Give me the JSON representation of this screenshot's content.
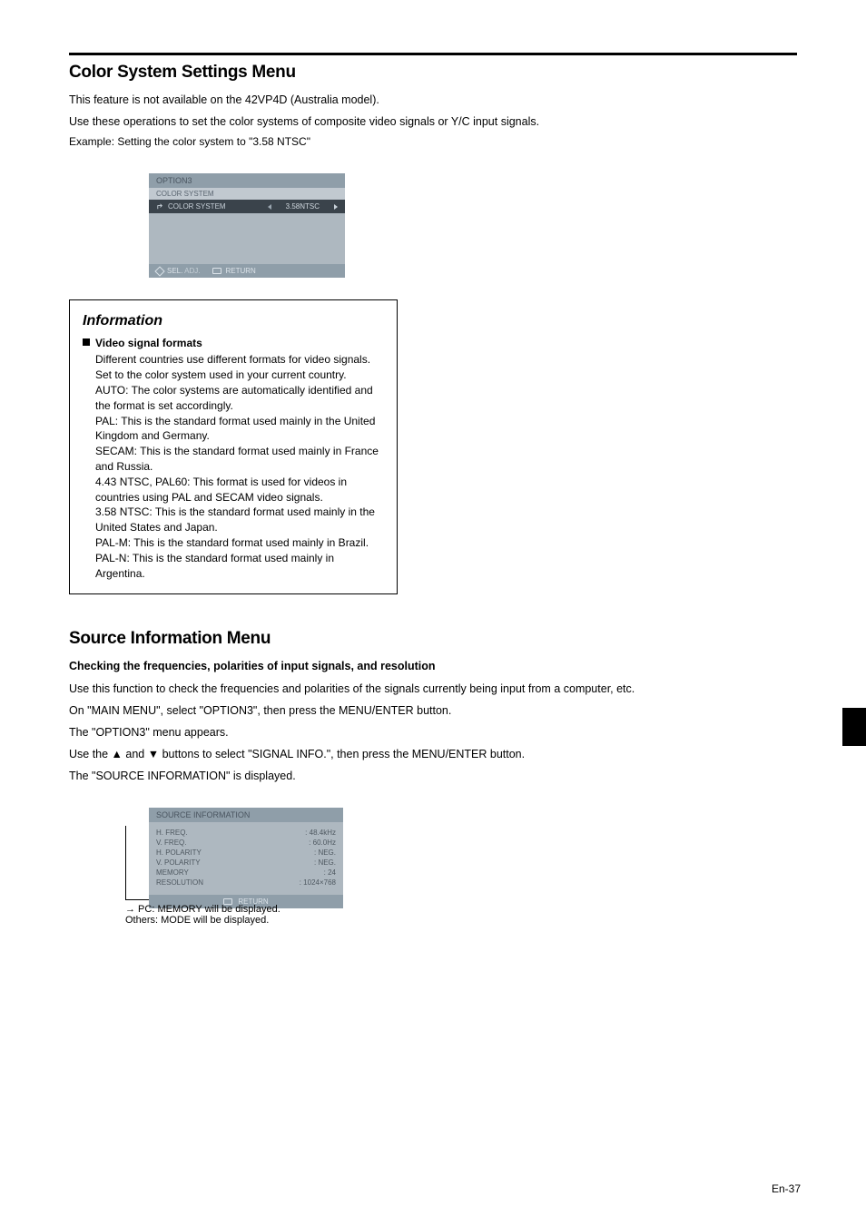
{
  "section1": {
    "heading": "Color System Settings Menu",
    "intro": "This feature is not available on the 42VP4D (Australia model).",
    "desc": "Use these operations to set the color systems of composite video signals or Y/C input signals.",
    "example": "Example: Setting the color system to \"3.58 NTSC\""
  },
  "osd1": {
    "title": "OPTION3",
    "subhead": "COLOR SYSTEM",
    "row_label": "COLOR SYSTEM",
    "row_value": "3.58NTSC",
    "footer_sel": "SEL.",
    "footer_adj": "ADJ.",
    "footer_ret": "RETURN"
  },
  "infoBox": {
    "title": "Information",
    "bullet_heading": "Video signal formats",
    "lead_in": "Different countries use different formats for video signals. Set to the color system used in your current country.",
    "items": [
      {
        "k": "AUTO:",
        "v": "The color systems are automatically identified and the format is set accordingly."
      },
      {
        "k": "PAL:",
        "v": "This is the standard format used mainly in the United Kingdom and Germany."
      },
      {
        "k": "SECAM:",
        "v": "This is the standard format used mainly in France and Russia."
      },
      {
        "k": "4.43 NTSC, PAL60:",
        "v": "This format is used for videos in countries using PAL and SECAM video signals."
      },
      {
        "k": "3.58 NTSC:",
        "v": "This is the standard format used mainly in the United States and Japan."
      },
      {
        "k": "PAL-M:",
        "v": "This is the standard format used mainly in Brazil."
      },
      {
        "k": "PAL-N:",
        "v": "This is the standard format used mainly in Argentina."
      }
    ]
  },
  "section2": {
    "heading": "Source Information Menu",
    "sub": "Checking the frequencies, polarities of input signals, and resolution",
    "desc": "Use this function to check the frequencies and polarities of the signals currently being input from a computer, etc.",
    "steps": "On \"MAIN MENU\", select \"OPTION3\", then press the MENU/ENTER button.",
    "steps2": "The \"OPTION3\" menu appears.",
    "steps3": "Use the ▲ and ▼ buttons to select \"SIGNAL INFO.\", then press the MENU/ENTER button.",
    "steps4": "The \"SOURCE INFORMATION\" is displayed."
  },
  "osd2": {
    "title": "SOURCE INFORMATION",
    "rows": [
      {
        "k": "H. FREQ.",
        "v_left": ":",
        "v_right": "48.4kHz"
      },
      {
        "k": "V. FREQ.",
        "v_left": ":",
        "v_right": "60.0Hz"
      },
      {
        "k": "H. POLARITY",
        "v_left": ":",
        "v_right": "NEG."
      },
      {
        "k": "V. POLARITY",
        "v_left": ":",
        "v_right": "NEG."
      },
      {
        "k": "MEMORY",
        "v_left": ":",
        "v_right": "24"
      },
      {
        "k": "RESOLUTION",
        "v_left": ":",
        "v_right": "1024×768"
      }
    ],
    "footer": "RETURN",
    "leader_label": "→ PC: MEMORY will be displayed.",
    "leader_label2": "Others: MODE will be displayed."
  },
  "footer": {
    "page": "En-37"
  }
}
